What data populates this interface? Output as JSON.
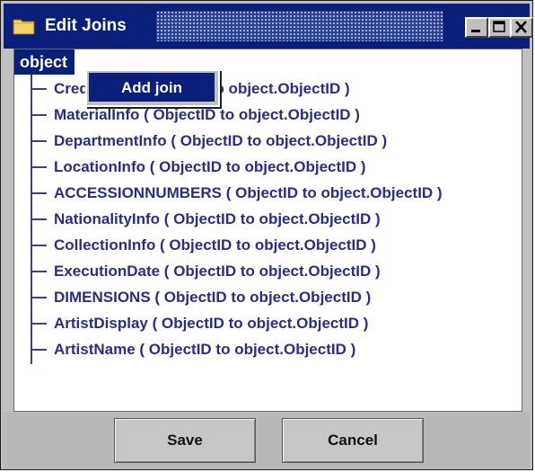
{
  "window": {
    "title": "Edit Joins"
  },
  "tree": {
    "root": "object",
    "children": [
      "CreditLine ( ObjectID to object.ObjectID )",
      "MaterialInfo ( ObjectID to object.ObjectID )",
      "DepartmentInfo ( ObjectID to object.ObjectID )",
      "LocationInfo ( ObjectID to object.ObjectID )",
      "ACCESSIONNUMBERS ( ObjectID to object.ObjectID )",
      "NationalityInfo ( ObjectID to object.ObjectID )",
      "CollectionInfo ( ObjectID to object.ObjectID )",
      "ExecutionDate ( ObjectID to object.ObjectID )",
      "DIMENSIONS ( ObjectID to object.ObjectID )",
      "ArtistDisplay ( ObjectID to object.ObjectID )",
      "ArtistName ( ObjectID to object.ObjectID )"
    ]
  },
  "context_menu": {
    "items": [
      "Add join"
    ]
  },
  "buttons": {
    "save": "Save",
    "cancel": "Cancel"
  },
  "colors": {
    "selection": "#0a1f7a",
    "tree_text": "#2b2b8a",
    "window_bg": "#c0c0c0"
  },
  "icons": {
    "title": "folder-icon",
    "minimize": "minimize-icon",
    "maximize": "maximize-icon",
    "close": "close-icon"
  }
}
